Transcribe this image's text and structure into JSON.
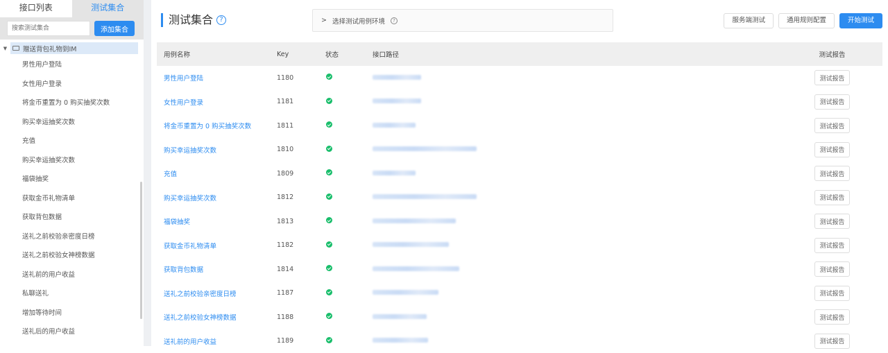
{
  "sidebar": {
    "tabs": [
      "接口列表",
      "测试集合"
    ],
    "search_placeholder": "搜索测试集合",
    "add_button": "添加集合",
    "root": "赠送背包礼物到IM",
    "items": [
      "男性用户登陆",
      "女性用户登录",
      "将金币重置为 0 购买抽奖次数",
      "购买幸运抽奖次数",
      "充值",
      "购买幸运抽奖次数",
      "福袋抽奖",
      "获取金币礼物清单",
      "获取背包数据",
      "送礼之前校验亲密度日榜",
      "送礼之前校验女神榜数据",
      "送礼前的用户收益",
      "私聊送礼",
      "增加等待时间",
      "送礼后的用户收益"
    ]
  },
  "header": {
    "title": "测试集合",
    "env_label": "选择测试用例环境",
    "buttons": [
      "服务端测试",
      "通用规则配置",
      "开始测试"
    ]
  },
  "table": {
    "columns": [
      "用例名称",
      "Key",
      "状态",
      "接口路径",
      "测试报告"
    ],
    "report_label": "测试报告",
    "rows": [
      {
        "name": "男性用户登陆",
        "key": "1180"
      },
      {
        "name": "女性用户登录",
        "key": "1181"
      },
      {
        "name": "将金币重置为 0 购买抽奖次数",
        "key": "1811"
      },
      {
        "name": "购买幸运抽奖次数",
        "key": "1810"
      },
      {
        "name": "充值",
        "key": "1809"
      },
      {
        "name": "购买幸运抽奖次数",
        "key": "1812"
      },
      {
        "name": "福袋抽奖",
        "key": "1813"
      },
      {
        "name": "获取金币礼物清单",
        "key": "1182"
      },
      {
        "name": "获取背包数据",
        "key": "1814"
      },
      {
        "name": "送礼之前校验亲密度日榜",
        "key": "1187"
      },
      {
        "name": "送礼之前校验女神榜数据",
        "key": "1188"
      },
      {
        "name": "送礼前的用户收益",
        "key": "1189"
      }
    ]
  },
  "colors": {
    "accent": "#2d8cf0",
    "success": "#19be6b"
  }
}
